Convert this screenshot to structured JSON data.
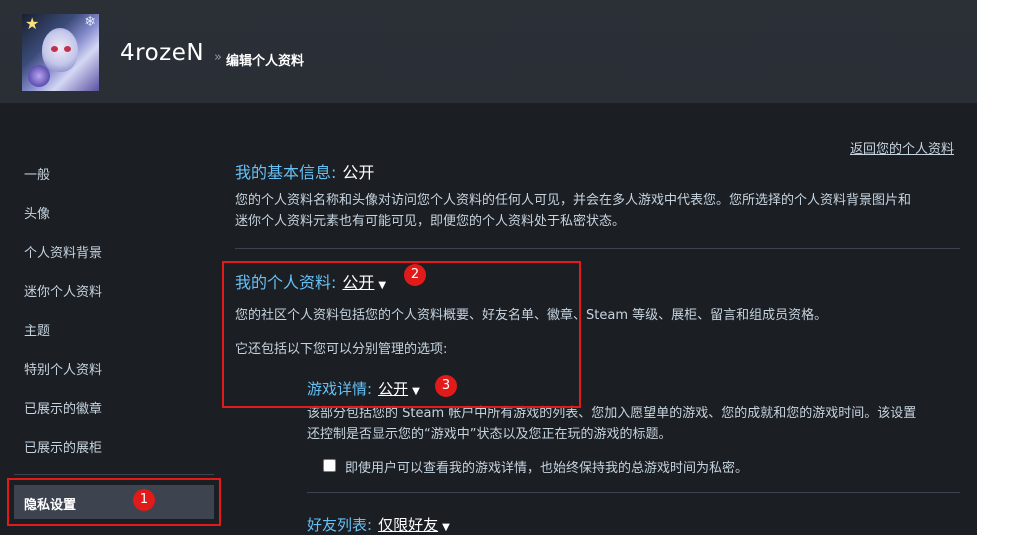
{
  "header": {
    "username": "4rozeN",
    "separator": "»",
    "breadcrumb": "编辑个人资料"
  },
  "sidebar": {
    "items": [
      {
        "label": "一般"
      },
      {
        "label": "头像"
      },
      {
        "label": "个人资料背景"
      },
      {
        "label": "迷你个人资料"
      },
      {
        "label": "主题"
      },
      {
        "label": "特别个人资料"
      },
      {
        "label": "已展示的徽章"
      },
      {
        "label": "已展示的展柜"
      }
    ],
    "active": "隐私设置"
  },
  "main": {
    "back_link": "返回您的个人资料",
    "basic": {
      "title": "我的基本信息:",
      "value": "公开",
      "desc_line1": "您的个人资料名称和头像对访问您个人资料的任何人可见，并会在多人游戏中代表您。您所选择的个人资料背景图片和",
      "desc_line2": "迷你个人资料元素也有可能可见，即便您的个人资料处于私密状态。"
    },
    "profile": {
      "title": "我的个人资料:",
      "value": "公开",
      "desc": "您的社区个人资料包括您的个人资料概要、好友名单、徽章、Steam 等级、展柜、留言和组成员资格。",
      "sub_intro": "它还包括以下您可以分别管理的选项:"
    },
    "game_details": {
      "title": "游戏详情:",
      "value": "公开",
      "desc_line1": "该部分包括您的 Steam 帐户中所有游戏的列表、您加入愿望单的游戏、您的成就和您的游戏时间。该设置",
      "desc_line2": "还控制是否显示您的“游戏中”状态以及您正在玩的游戏的标题。",
      "checkbox_label": "即使用户可以查看我的游戏详情，也始终保持我的总游戏时间为私密。"
    },
    "friends": {
      "title": "好友列表:",
      "value": "仅限好友"
    }
  },
  "annotations": {
    "badge1": "1",
    "badge2": "2",
    "badge3": "3",
    "color": "#e11a1a"
  },
  "colors": {
    "accent": "#66c0f4",
    "background": "#1b1e23",
    "header": "#2a2e35"
  }
}
